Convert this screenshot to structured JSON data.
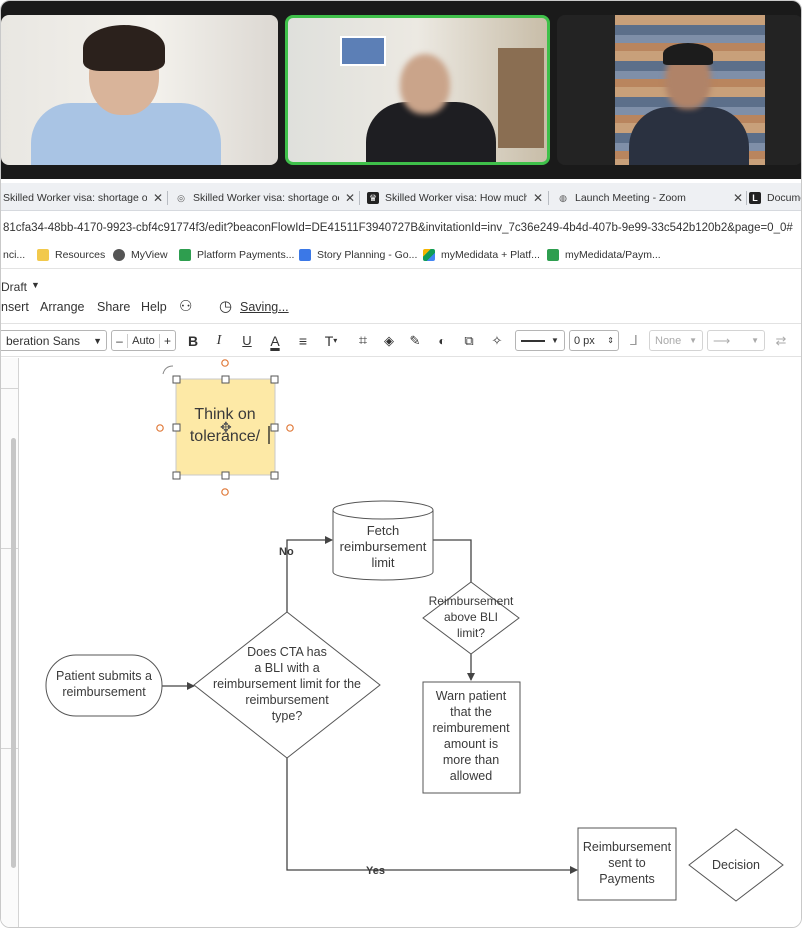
{
  "tabs": [
    {
      "label": "Skilled Worker visa: shortage occ",
      "icon": "gov-icon"
    },
    {
      "label": "Skilled Worker visa: shortage occ",
      "icon": "gov-icon"
    },
    {
      "label": "Skilled Worker visa: How much",
      "icon": "crown-icon"
    },
    {
      "label": "Launch Meeting - Zoom",
      "icon": "globe-icon"
    },
    {
      "label": "Docume",
      "icon": "lucid-icon"
    }
  ],
  "address": {
    "url": "81cfa34-48bb-4170-9923-cbf4c91774f3/edit?beaconFlowId=DE41511F3940727B&invitationId=inv_7c36e249-4b4d-407b-9e99-33c542b120b2&page=0_0#"
  },
  "bookmarks": [
    {
      "label": "nci...",
      "color": "#2e7d32"
    },
    {
      "label": "Resources",
      "color": "#f2c94c"
    },
    {
      "label": "MyView",
      "color": "#555555"
    },
    {
      "label": "Platform Payments...",
      "color": "#2e9e4f"
    },
    {
      "label": "Story Planning - Go...",
      "color": "#3b78e7"
    },
    {
      "label": "myMedidata + Platf...",
      "color": "#f4b400"
    },
    {
      "label": "myMedidata/Paym...",
      "color": "#2e9e4f"
    }
  ],
  "app": {
    "doc_status": "Draft",
    "menu": [
      "nsert",
      "Arrange",
      "Share",
      "Help"
    ],
    "saving": "Saving..."
  },
  "format_bar": {
    "font": "beration Sans",
    "size": "Auto",
    "minus": "–",
    "plus": "+",
    "bold": "B",
    "italic": "I",
    "underline": "U",
    "text_color": "A",
    "text_type": "T",
    "line_width": "0 px",
    "arrow_start": "None"
  },
  "diagram": {
    "sticky": [
      "Think on",
      "tolerance/"
    ],
    "fetch": [
      "Fetch",
      "reimbursement",
      "limit"
    ],
    "no_label": "No",
    "yes_label": "Yes",
    "decision_bli": [
      "Does CTA has",
      "a BLI with a",
      "reimbursement limit for the",
      "reimbursement",
      "type?"
    ],
    "start": [
      "Patient submits a",
      "reimbursement"
    ],
    "decision_above": [
      "Reimbursement",
      "above BLI",
      "limit?"
    ],
    "warn": [
      "Warn patient",
      "that the",
      "reimburement",
      "amount is",
      "more than",
      "allowed"
    ],
    "sent": [
      "Reimbursement",
      "sent to",
      "Payments"
    ],
    "decision_legend": "Decision"
  },
  "colors": {
    "active_speaker": "#3fc04a",
    "sticky_fill": "#fde9a6",
    "handle_orange": "#e07a3a"
  }
}
